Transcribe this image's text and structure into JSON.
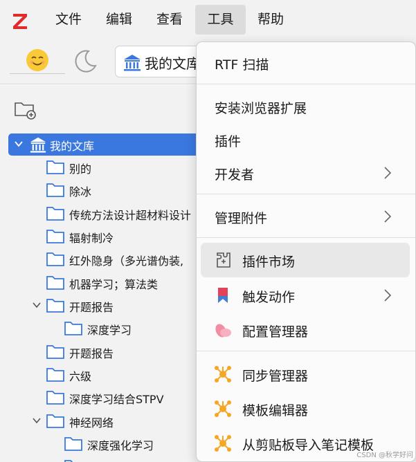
{
  "menubar": {
    "items": [
      "文件",
      "编辑",
      "查看",
      "工具",
      "帮助"
    ]
  },
  "toolbar": {
    "library_label": "我的文库"
  },
  "tree": [
    {
      "label": "我的文库",
      "type": "library",
      "expanded": true,
      "selected": true
    },
    {
      "label": "别的"
    },
    {
      "label": "除冰"
    },
    {
      "label": "传统方法设计超材料设计"
    },
    {
      "label": "辐射制冷"
    },
    {
      "label": "红外隐身（多光谱伪装,"
    },
    {
      "label": "机器学习；算法类"
    },
    {
      "label": "开题报告",
      "expanded": true
    },
    {
      "label": "深度学习"
    },
    {
      "label": "开题报告"
    },
    {
      "label": "六级"
    },
    {
      "label": "深度学习结合STPV"
    },
    {
      "label": "神经网络",
      "expanded": true
    },
    {
      "label": "深度强化学习"
    }
  ],
  "tools_menu": {
    "items": [
      {
        "label": "RTF 扫描"
      },
      {
        "label": "安装浏览器扩展"
      },
      {
        "label": "插件"
      },
      {
        "label": "开发者",
        "submenu": true
      },
      {
        "label": "管理附件",
        "submenu": true
      },
      {
        "label": "插件市场",
        "icon": "plugin-market-icon",
        "hover": true
      },
      {
        "label": "触发动作",
        "icon": "bookmark-trigger-icon",
        "submenu": true
      },
      {
        "label": "配置管理器",
        "icon": "petals-config-icon"
      },
      {
        "label": "同步管理器",
        "icon": "orange-network-icon"
      },
      {
        "label": "模板编辑器",
        "icon": "orange-network-icon"
      },
      {
        "label": "从剪贴板导入笔记模板",
        "icon": "orange-network-icon"
      }
    ]
  },
  "watermark": "CSDN @秋学好问",
  "colors": {
    "accent": "#3a78e0",
    "logo_red": "#e02b2b",
    "folder_blue": "#3a78e0",
    "network_orange": "#f5a623",
    "bookmark_red": "#e0435a",
    "petal_pink": "#f28ca0"
  }
}
